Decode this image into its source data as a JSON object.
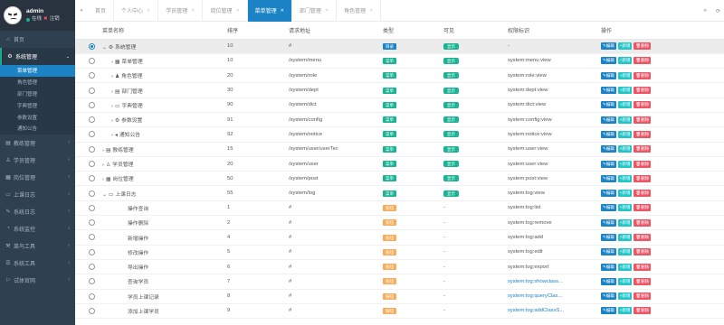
{
  "profile": {
    "name": "admin",
    "online": "在线",
    "logout": "注销"
  },
  "nav": [
    {
      "icon": "⌂",
      "label": "首页",
      "open": false,
      "children": []
    },
    {
      "icon": "⚙",
      "label": "系统管理",
      "open": true,
      "children": [
        {
          "label": "菜单管理",
          "active": true
        },
        {
          "label": "角色管理",
          "active": false
        },
        {
          "label": "部门管理",
          "active": false
        },
        {
          "label": "字典管理",
          "active": false
        },
        {
          "label": "参数设置",
          "active": false
        },
        {
          "label": "通知公告",
          "active": false
        }
      ]
    },
    {
      "icon": "▤",
      "label": "教练管理",
      "open": false,
      "children": []
    },
    {
      "icon": "♙",
      "label": "学员管理",
      "open": false,
      "children": []
    },
    {
      "icon": "▦",
      "label": "岗位管理",
      "open": false,
      "children": []
    },
    {
      "icon": "▭",
      "label": "上课日志",
      "open": false,
      "children": []
    },
    {
      "icon": "✎",
      "label": "系统日志",
      "open": false,
      "children": []
    },
    {
      "icon": "◔",
      "label": "系统监控",
      "open": false,
      "children": []
    },
    {
      "icon": "⚒",
      "label": "菜鸟工具",
      "open": false,
      "children": []
    },
    {
      "icon": "☰",
      "label": "系统工具",
      "open": false,
      "children": []
    },
    {
      "icon": "⚐",
      "label": "试体官网",
      "open": false,
      "children": []
    }
  ],
  "tabs": [
    {
      "label": "首页",
      "active": false,
      "closable": false
    },
    {
      "label": "个人中心",
      "active": false,
      "closable": true
    },
    {
      "label": "学员管理",
      "active": false,
      "closable": true
    },
    {
      "label": "岗位管理",
      "active": false,
      "closable": true
    },
    {
      "label": "菜单管理",
      "active": true,
      "closable": true
    },
    {
      "label": "部门管理",
      "active": false,
      "closable": true
    },
    {
      "label": "角色管理",
      "active": false,
      "closable": true
    }
  ],
  "table": {
    "headers": [
      "菜单名称",
      "排序",
      "请求地址",
      "类型",
      "可见",
      "权限标识",
      "操作"
    ],
    "action_labels": {
      "edit": "编辑",
      "add": "新增",
      "del": "删除"
    },
    "rows": [
      {
        "sel": true,
        "depth": 0,
        "exp": "⌄",
        "icon": "⚙",
        "name": "系统管理",
        "order": "10",
        "url": "#",
        "type": "目录",
        "typeColor": "blue",
        "visible": "显示",
        "perm": "-",
        "link": false
      },
      {
        "sel": false,
        "depth": 1,
        "exp": "›",
        "icon": "▦",
        "name": "菜单管理",
        "order": "10",
        "url": "/system/menu",
        "type": "菜单",
        "typeColor": "teal",
        "visible": "显示",
        "perm": "system:menu:view",
        "link": false
      },
      {
        "sel": false,
        "depth": 1,
        "exp": "›",
        "icon": "♟",
        "name": "角色管理",
        "order": "20",
        "url": "/system/role",
        "type": "菜单",
        "typeColor": "teal",
        "visible": "显示",
        "perm": "system:role:view",
        "link": false
      },
      {
        "sel": false,
        "depth": 1,
        "exp": "›",
        "icon": "▤",
        "name": "部门管理",
        "order": "30",
        "url": "/system/dept",
        "type": "菜单",
        "typeColor": "teal",
        "visible": "显示",
        "perm": "system:dept:view",
        "link": false
      },
      {
        "sel": false,
        "depth": 1,
        "exp": "›",
        "icon": "▭",
        "name": "字典管理",
        "order": "90",
        "url": "/system/dict",
        "type": "菜单",
        "typeColor": "teal",
        "visible": "显示",
        "perm": "system:dict:view",
        "link": false
      },
      {
        "sel": false,
        "depth": 1,
        "exp": "›",
        "icon": "⚙",
        "name": "参数设置",
        "order": "91",
        "url": "/system/config",
        "type": "菜单",
        "typeColor": "teal",
        "visible": "显示",
        "perm": "system:config:view",
        "link": false
      },
      {
        "sel": false,
        "depth": 1,
        "exp": "›",
        "icon": "◂",
        "name": "通知公告",
        "order": "92",
        "url": "/system/notice",
        "type": "菜单",
        "typeColor": "teal",
        "visible": "显示",
        "perm": "system:notice:view",
        "link": false
      },
      {
        "sel": false,
        "depth": 0,
        "exp": "›",
        "icon": "▤",
        "name": "教练管理",
        "order": "15",
        "url": "/system/user/userTec",
        "type": "菜单",
        "typeColor": "teal",
        "visible": "显示",
        "perm": "system:user:view",
        "link": false
      },
      {
        "sel": false,
        "depth": 0,
        "exp": "›",
        "icon": "♙",
        "name": "学员管理",
        "order": "20",
        "url": "/system/user",
        "type": "菜单",
        "typeColor": "teal",
        "visible": "显示",
        "perm": "system:user:view",
        "link": false
      },
      {
        "sel": false,
        "depth": 0,
        "exp": "›",
        "icon": "▦",
        "name": "岗位管理",
        "order": "50",
        "url": "/system/post",
        "type": "菜单",
        "typeColor": "teal",
        "visible": "显示",
        "perm": "system:post:view",
        "link": false
      },
      {
        "sel": false,
        "depth": 0,
        "exp": "⌄",
        "icon": "▭",
        "name": "上课日志",
        "order": "55",
        "url": "/system/log",
        "type": "菜单",
        "typeColor": "teal",
        "visible": "显示",
        "perm": "system:log:view",
        "link": false
      },
      {
        "sel": false,
        "depth": 2,
        "exp": "",
        "icon": "",
        "name": "操作查询",
        "order": "1",
        "url": "#",
        "type": "按钮",
        "typeColor": "orange",
        "visible": "-",
        "perm": "system:log:list",
        "link": false
      },
      {
        "sel": false,
        "depth": 2,
        "exp": "",
        "icon": "",
        "name": "操作删除",
        "order": "2",
        "url": "#",
        "type": "按钮",
        "typeColor": "orange",
        "visible": "-",
        "perm": "system:log:remove",
        "link": false
      },
      {
        "sel": false,
        "depth": 2,
        "exp": "",
        "icon": "",
        "name": "新增操作",
        "order": "4",
        "url": "#",
        "type": "按钮",
        "typeColor": "orange",
        "visible": "-",
        "perm": "system:log:add",
        "link": false
      },
      {
        "sel": false,
        "depth": 2,
        "exp": "",
        "icon": "",
        "name": "修改操作",
        "order": "5",
        "url": "#",
        "type": "按钮",
        "typeColor": "orange",
        "visible": "-",
        "perm": "system:log:edit",
        "link": false
      },
      {
        "sel": false,
        "depth": 2,
        "exp": "",
        "icon": "",
        "name": "导出操作",
        "order": "6",
        "url": "#",
        "type": "按钮",
        "typeColor": "orange",
        "visible": "-",
        "perm": "system:log:export",
        "link": false
      },
      {
        "sel": false,
        "depth": 2,
        "exp": "",
        "icon": "",
        "name": "查询学员",
        "order": "7",
        "url": "#",
        "type": "按钮",
        "typeColor": "orange",
        "visible": "-",
        "perm": "system:log:showclass...",
        "link": true
      },
      {
        "sel": false,
        "depth": 2,
        "exp": "",
        "icon": "",
        "name": "学员上课记录",
        "order": "8",
        "url": "#",
        "type": "按钮",
        "typeColor": "orange",
        "visible": "-",
        "perm": "system:log:queryClas...",
        "link": true
      },
      {
        "sel": false,
        "depth": 2,
        "exp": "",
        "icon": "",
        "name": "添加上课学员",
        "order": "9",
        "url": "#",
        "type": "按钮",
        "typeColor": "orange",
        "visible": "-",
        "perm": "system:log:addClassS...",
        "link": true
      }
    ]
  }
}
